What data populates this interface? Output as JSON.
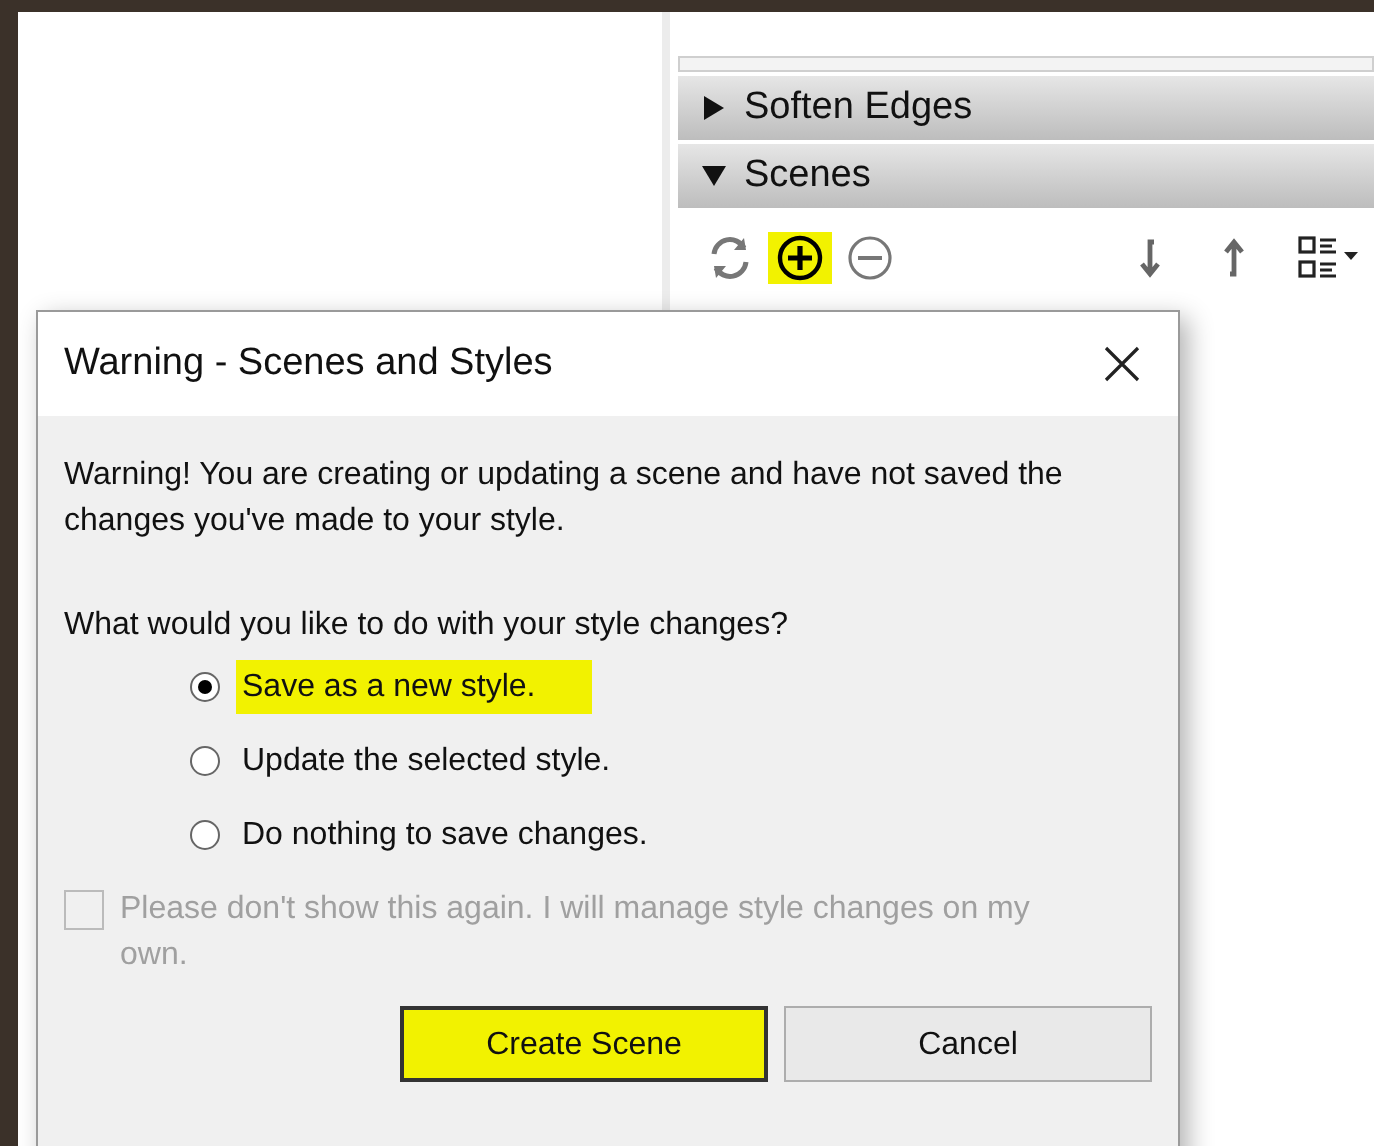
{
  "panel": {
    "sections": [
      {
        "label": "Soften Edges",
        "expanded": false
      },
      {
        "label": "Scenes",
        "expanded": true
      }
    ],
    "toolbar": [
      {
        "kind": "refresh",
        "highlighted": false
      },
      {
        "kind": "add",
        "highlighted": true
      },
      {
        "kind": "remove",
        "highlighted": false
      },
      {
        "kind": "down",
        "highlighted": false
      },
      {
        "kind": "up",
        "highlighted": false
      },
      {
        "kind": "view",
        "highlighted": false
      }
    ]
  },
  "dialog": {
    "title": "Warning - Scenes and Styles",
    "message": "Warning! You are creating or updating a scene and have not saved the changes you've made to your style.",
    "question": "What would you like to do with your style changes?",
    "options": [
      {
        "label": "Save as a new style.",
        "selected": true,
        "highlighted": true
      },
      {
        "label": "Update the selected style.",
        "selected": false,
        "highlighted": false
      },
      {
        "label": "Do nothing to save changes.",
        "selected": false,
        "highlighted": false
      }
    ],
    "checkbox": {
      "label": "Please don't show this again.  I will manage style changes on my own.",
      "checked": false,
      "disabled": true
    },
    "buttons": [
      {
        "label": "Create Scene",
        "default": true,
        "highlighted": true
      },
      {
        "label": "Cancel",
        "default": false,
        "highlighted": false
      }
    ]
  }
}
